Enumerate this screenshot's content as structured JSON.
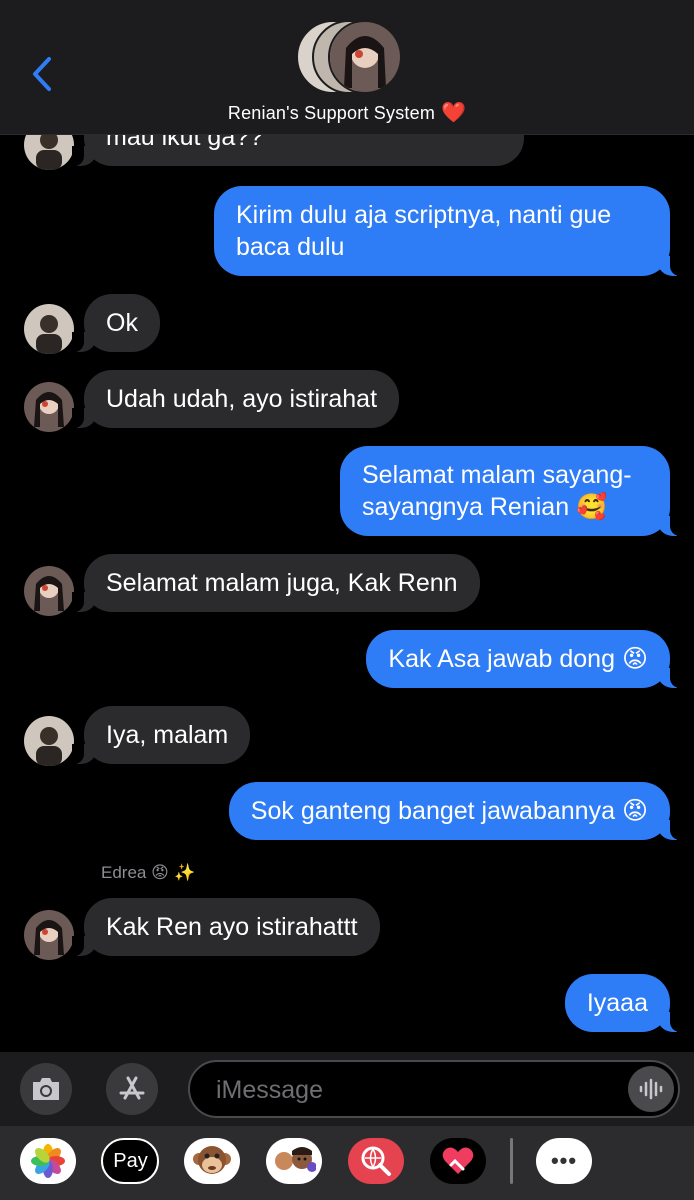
{
  "header": {
    "group_name": "Renian's Support System",
    "heart": "❤️"
  },
  "messages": {
    "m0": "mau ikut ga??",
    "m1_line1": "Kirim dulu aja scriptnya, nanti gue",
    "m1_line2": "baca dulu",
    "m2": "Ok",
    "m3": "Udah udah, ayo istirahat",
    "m4_line1": "Selamat malam sayang-",
    "m4_line2": "sayangnya Renian",
    "m4_emoji": "🥰",
    "m5": "Selamat malam juga, Kak Renn",
    "m6": "Kak Asa jawab dong",
    "m6_emoji": "😡",
    "m7": "Iya, malam",
    "m8": "Sok ganteng banget jawabannya",
    "m8_emoji": "😡",
    "sender_name": "Edrea",
    "sender_emoji": "😡 ✨",
    "m9": "Kak Ren ayo istirahattt",
    "m10": "Iyaaa"
  },
  "input": {
    "placeholder": "iMessage"
  },
  "drawer": {
    "apps": [
      "photos-icon",
      "apple-pay",
      "monkey-animoji",
      "memoji",
      "search-images",
      "digital-touch",
      "more"
    ],
    "apple_pay_label": "Pay",
    "more_label": "•••"
  },
  "colors": {
    "outgoing": "#2f7df6",
    "incoming": "#2b2b2d",
    "accent": "#2f7df6",
    "heart": "#d81b2a"
  }
}
